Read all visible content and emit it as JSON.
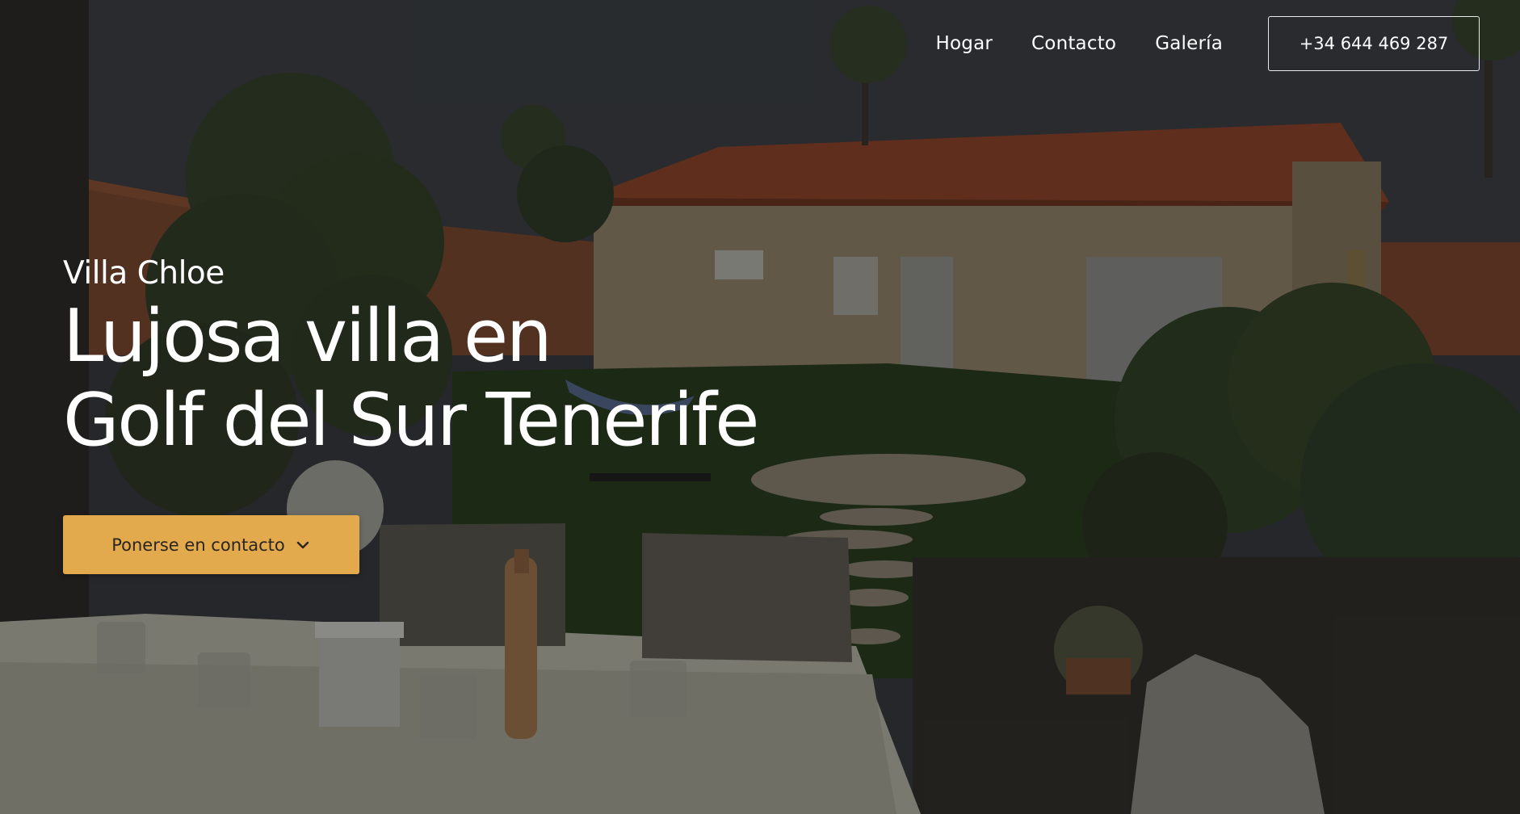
{
  "nav": {
    "links": [
      "Hogar",
      "Contacto",
      "Galería"
    ],
    "phone": "+34 644 469 287"
  },
  "hero": {
    "subtitle": "Villa Chloe",
    "headline_line1": "Lujosa villa en",
    "headline_line2": "Golf del Sur Tenerife",
    "cta_label": "Ponerse en contacto",
    "cta_icon": "chevron-down-icon"
  },
  "colors": {
    "accent": "#e3a94d",
    "text": "#ffffff"
  }
}
